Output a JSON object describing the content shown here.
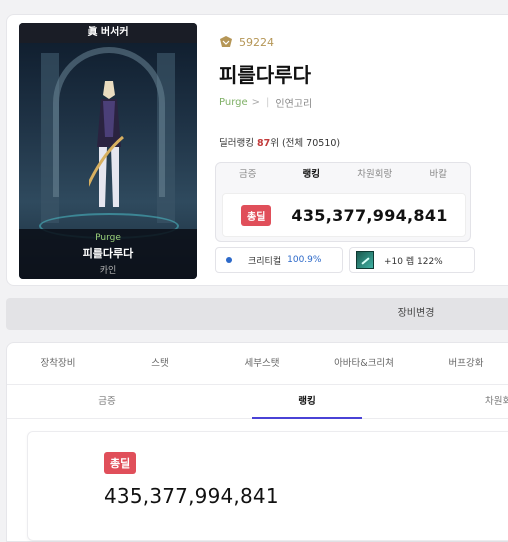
{
  "character": {
    "class_title": "眞 버서커",
    "guild": "Purge",
    "name": "피를다루다",
    "server": "카인",
    "fame": "59224",
    "adventure": "인연고리",
    "dealer_rank_prefix": "딜러랭킹 ",
    "dealer_rank_num": "87",
    "dealer_rank_suffix": "위 (전체 70510)"
  },
  "rank_box": {
    "tabs": [
      "금증",
      "랭킹",
      "차원회랑",
      "바칼"
    ],
    "active_tab": 1,
    "badge": "총딜",
    "value": "435,377,994,841"
  },
  "buffs": {
    "crit_label": "크리티컬",
    "crit_value": "100.9%",
    "skill_text": "+10 렙 122%"
  },
  "change_equipment": "장비변경",
  "main_tabs": [
    "장착장비",
    "스탯",
    "세부스탯",
    "아바타&크리쳐",
    "버프강화"
  ],
  "sub_tabs": [
    "금증",
    "랭킹",
    "차원회"
  ],
  "rank_panel": {
    "badge": "총딜",
    "value": "435,377,994,841"
  },
  "colors": {
    "accent": "#4a42d6",
    "badge": "#e04f5a",
    "fame": "#b59656"
  }
}
